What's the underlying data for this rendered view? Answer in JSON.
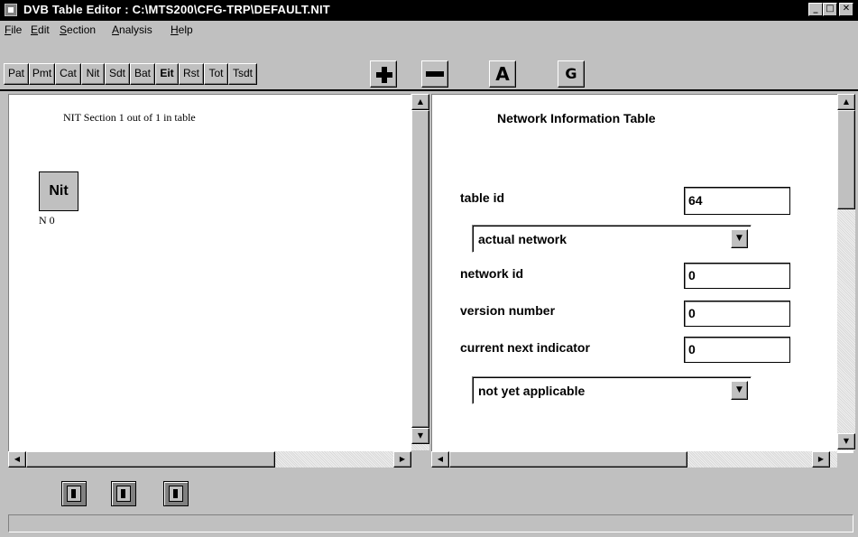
{
  "window": {
    "title": "DVB Table Editor : C:\\MTS200\\CFG-TRP\\DEFAULT.NIT",
    "minimize": "_",
    "maximize": "□",
    "close": "✕"
  },
  "menu": {
    "file": {
      "accel": "F",
      "rest": "ile"
    },
    "edit": {
      "accel": "E",
      "rest": "dit"
    },
    "section": {
      "accel": "S",
      "rest": "ection"
    },
    "analysis": {
      "accel": "A",
      "rest": "nalysis"
    },
    "help": {
      "accel": "H",
      "rest": "elp"
    }
  },
  "toolbar": {
    "tables": [
      "Pat",
      "Pmt",
      "Cat",
      "Nit",
      "Sdt",
      "Bat",
      "Eit",
      "Rst",
      "Tot",
      "Tsdt"
    ],
    "icons": [
      "plus-icon",
      "minus-icon",
      "letter-a-icon",
      "letter-g-icon"
    ],
    "a_label": "A",
    "g_label": "G"
  },
  "left_pane": {
    "section_label": "NIT Section 1 out of 1 in table",
    "node_label": "Nit",
    "node_caption": "N 0"
  },
  "right_pane": {
    "title": "Network Information Table",
    "table_id_label": "table id",
    "table_id_value": "64",
    "network_type": "actual network",
    "network_id_label": "network id",
    "network_id_value": "0",
    "version_label": "version number",
    "version_value": "0",
    "cni_label": "current next indicator",
    "cni_value": "0",
    "applicability": "not yet applicable"
  },
  "scroll_arrows": {
    "up": "▲",
    "down": "▼",
    "left": "◀",
    "right": "▶"
  },
  "bottom_nav": [
    "previous-section-icon",
    "info-icon",
    "next-section-icon"
  ]
}
